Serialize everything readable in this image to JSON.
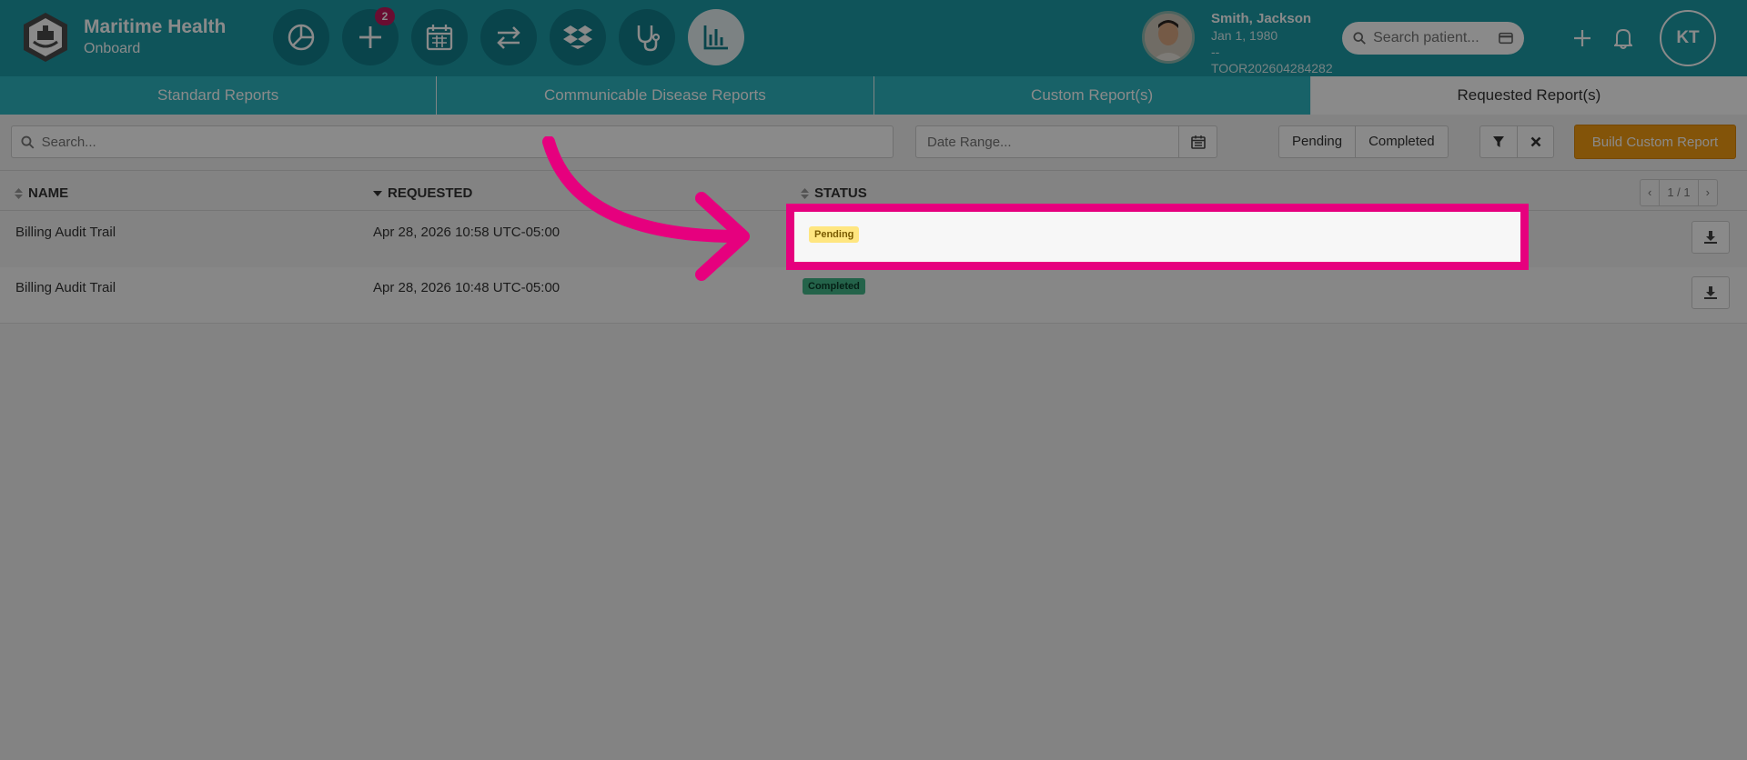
{
  "app": {
    "name": "Maritime Health",
    "subtitle": "Onboard"
  },
  "nav": {
    "badge_count": "2"
  },
  "patient": {
    "name": "Smith, Jackson",
    "dob": "Jan 1, 1980",
    "line3": "--",
    "id": "TOOR202604284282"
  },
  "header": {
    "search_placeholder": "Search patient...",
    "user_initials": "KT"
  },
  "tabs": [
    {
      "label": "Standard Reports"
    },
    {
      "label": "Communicable Disease Reports"
    },
    {
      "label": "Custom Report(s)"
    },
    {
      "label": "Requested Report(s)"
    }
  ],
  "toolbar": {
    "search_placeholder": "Search...",
    "date_placeholder": "Date Range...",
    "filter_pending": "Pending",
    "filter_completed": "Completed",
    "build_button": "Build Custom Report"
  },
  "table": {
    "columns": {
      "name": "NAME",
      "requested": "REQUESTED",
      "status": "STATUS"
    },
    "pager": {
      "prev": "‹",
      "page": "1 / 1",
      "next": "›"
    },
    "rows": [
      {
        "name": "Billing Audit Trail",
        "requested": "Apr 28, 2026 10:58 UTC-05:00",
        "status": "Pending"
      },
      {
        "name": "Billing Audit Trail",
        "requested": "Apr 28, 2026 10:48 UTC-05:00",
        "status": "Completed"
      }
    ]
  },
  "colors": {
    "header": "#1d9ba7",
    "tabs": "#2eb6c0",
    "accent_orange": "#f39c12",
    "highlight": "#e6007e"
  }
}
